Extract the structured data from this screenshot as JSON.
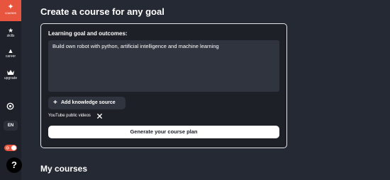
{
  "sidebar": {
    "active_item": {
      "label": "courses",
      "icon": "sparkle-icon"
    },
    "items": [
      {
        "label": "skills",
        "icon": "star-icon"
      },
      {
        "label": "career",
        "icon": "triangle-icon"
      },
      {
        "label": "upgrade",
        "icon": "crown-icon"
      }
    ],
    "settings_icon": "settings-icon",
    "language": "EN",
    "theme_toggle_icon": "sun-icon",
    "help_label": "?"
  },
  "main": {
    "title": "Create a course for any goal",
    "form": {
      "goal_label": "Learning goal and outcomes:",
      "goal_value": "Build own robot with python, artificial intelligence and machine learning",
      "add_source_icon": "+",
      "add_source_label": "Add knowledge source",
      "source_chip_label": "YouTube public videos",
      "generate_label": "Generate your course plan"
    },
    "my_courses_title": "My courses"
  },
  "colors": {
    "accent": "#e8553e",
    "background": "#252933",
    "sidebar": "#1e2129",
    "card": "#1d2027",
    "field": "#30343e"
  }
}
